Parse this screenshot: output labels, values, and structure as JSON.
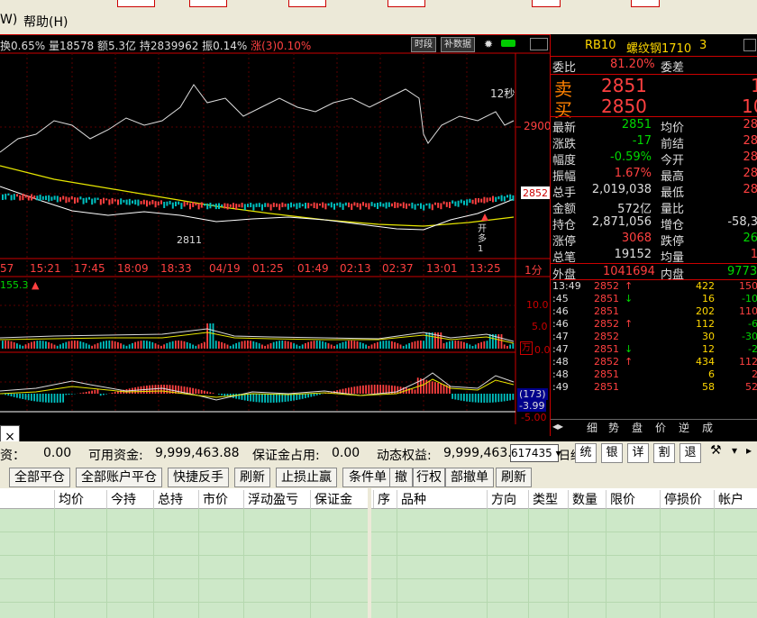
{
  "menu": {
    "item1": "W)",
    "item2": "帮助(H)"
  },
  "chart_info": {
    "label1": "换0.65%",
    "label2": "量18578",
    "label3": "额5.3亿",
    "label4": "持2839962",
    "label5": "振0.14%",
    "label6": "涨(3)0.10%",
    "btn_time": "时段",
    "btn_data": "补数据"
  },
  "chart": {
    "price_ylabels": [
      "2900",
      "2852"
    ],
    "annot_12s": "12秒",
    "annot_low": "2811",
    "annot_mark": "开多1",
    "time_labels": [
      "57",
      "15:21",
      "17:45",
      "18:09",
      "18:33",
      "04/19",
      "01:25",
      "01:49",
      "02:13",
      "02:37",
      "13:01",
      "13:25",
      "1分"
    ],
    "vol_label": "155.3",
    "vol_ticks": [
      "10.0",
      "5.0",
      "0.0"
    ],
    "vol_unit": "万",
    "macd_vals": [
      "(173)",
      "-3.99",
      "-5.00"
    ]
  },
  "quote": {
    "title": "RB10",
    "name": "螺纹钢1710",
    "code": "3",
    "wb_label": "委比",
    "wb_val": "81.20%",
    "wc_label": "委差",
    "sell_label": "卖",
    "sell_price": "2851",
    "sell_vol": "1",
    "buy_label": "买",
    "buy_price": "2850",
    "buy_vol": "10",
    "rows": [
      {
        "l1": "最新",
        "v1": "2851",
        "l2": "均价",
        "v2": "28"
      },
      {
        "l1": "涨跌",
        "v1": "-17",
        "l2": "前结",
        "v2": "28"
      },
      {
        "l1": "幅度",
        "v1": "-0.59%",
        "l2": "今开",
        "v2": "28"
      },
      {
        "l1": "振幅",
        "v1": "1.67%",
        "l2": "最高",
        "v2": "28"
      },
      {
        "l1": "总手",
        "v1": "2,019,038",
        "l2": "最低",
        "v2": "28"
      },
      {
        "l1": "金额",
        "v1": "572亿",
        "l2": "量比",
        "v2": ""
      },
      {
        "l1": "持仓",
        "v1": "2,871,056",
        "l2": "增仓",
        "v2": "-58,3"
      },
      {
        "l1": "涨停",
        "v1": "3068",
        "l2": "跌停",
        "v2": "26"
      },
      {
        "l1": "总笔",
        "v1": "19152",
        "l2": "均量",
        "v2": "1"
      }
    ],
    "out_label": "外盘",
    "out_val": "1041694",
    "in_label": "内盘",
    "in_val": "9773",
    "ticks": [
      {
        "t": "13:49",
        "p": "2852",
        "d": "↑",
        "v": "422",
        "c": "150"
      },
      {
        "t": ":45",
        "p": "2851",
        "d": "↓",
        "v": "16",
        "c": "-10"
      },
      {
        "t": ":46",
        "p": "2851",
        "d": "",
        "v": "202",
        "c": "110"
      },
      {
        "t": ":46",
        "p": "2852",
        "d": "↑",
        "v": "112",
        "c": "-6"
      },
      {
        "t": ":47",
        "p": "2852",
        "d": "",
        "v": "30",
        "c": "-30"
      },
      {
        "t": ":47",
        "p": "2851",
        "d": "↓",
        "v": "12",
        "c": "-2"
      },
      {
        "t": ":48",
        "p": "2852",
        "d": "↑",
        "v": "434",
        "c": "112"
      },
      {
        "t": ":48",
        "p": "2851",
        "d": "",
        "v": "6",
        "c": "2"
      },
      {
        "t": ":49",
        "p": "2851",
        "d": "",
        "v": "58",
        "c": "52"
      }
    ],
    "tabs": [
      "细",
      "势",
      "盘",
      "价",
      "逆",
      "成"
    ]
  },
  "status": {
    "s1": "资：",
    "s1v": "0.00",
    "s2": "可用资金:",
    "s2v": "9,999,463.88",
    "s3": "保证金占用:",
    "s3v": "0.00",
    "s4": "动态权益:",
    "s4v": "9,999,463.",
    "account": "617435",
    "s5": "日结",
    "btns": [
      "统",
      "银",
      "详",
      "割",
      "退"
    ]
  },
  "toolbar": {
    "b1": "全部平仓",
    "b2": "全部账户平仓",
    "b3": "快捷反手",
    "b4": "刷新",
    "b5": "止损止赢",
    "b6": "条件单",
    "b7": "撤",
    "b8": "行权",
    "b9": "部撤单",
    "b10": "刷新"
  },
  "left_table": {
    "cols": [
      "均价",
      "今持",
      "总持",
      "市价",
      "浮动盈亏",
      "保证金"
    ]
  },
  "right_table": {
    "cols": [
      "序",
      "品种",
      "方向",
      "类型",
      "数量",
      "限价",
      "停损价",
      "帐户"
    ]
  }
}
